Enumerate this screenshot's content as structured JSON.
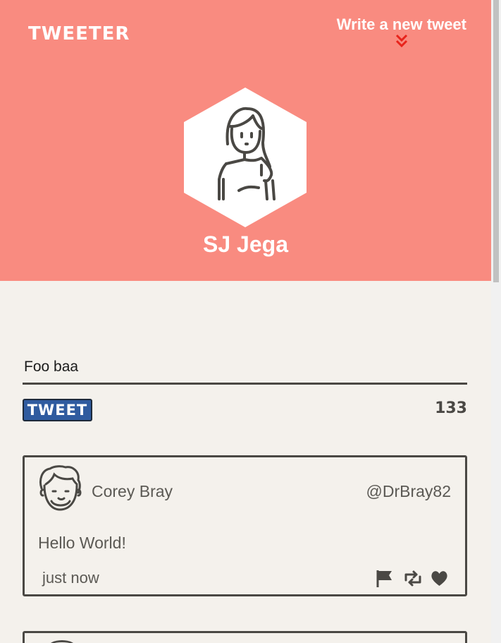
{
  "header": {
    "logo": "TWEETER",
    "compose_link": "Write a new tweet",
    "profile_name": "SJ Jega",
    "background_color": "#f98b80"
  },
  "compose": {
    "text": "Foo baa",
    "button_label": "TWEET",
    "char_count": "133",
    "button_color": "#2f5b9f"
  },
  "tweets": [
    {
      "author": "Corey Bray",
      "handle": "@DrBray82",
      "body": "Hello World!",
      "time": "just now",
      "actions": [
        "flag-icon",
        "retweet-icon",
        "heart-icon"
      ]
    }
  ]
}
